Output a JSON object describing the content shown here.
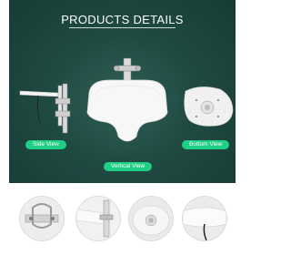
{
  "header": {
    "title": "PRODUCTS DETAILS"
  },
  "views": {
    "side_label": "Side View",
    "vertical_label": "Vertical View",
    "bottom_label": "Bottom View"
  },
  "colors": {
    "panel_bg": "#1f4a42",
    "label_bg": "#1fcf85",
    "label_text": "#ffffff"
  }
}
